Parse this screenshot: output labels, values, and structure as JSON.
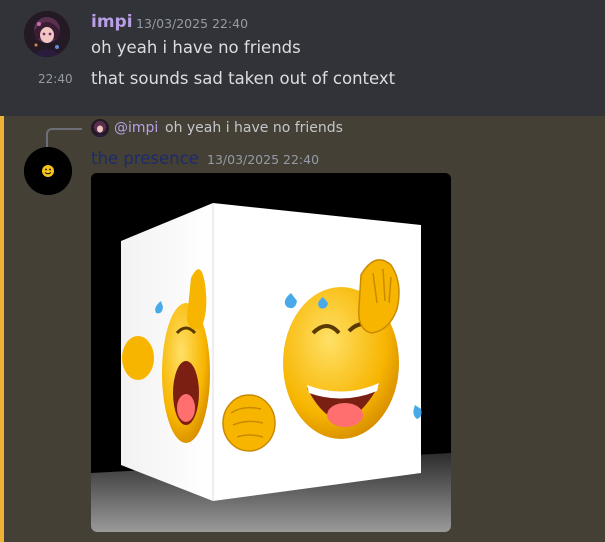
{
  "messages": [
    {
      "author": "impi",
      "timestamp": "13/03/2025 22:40",
      "lines": [
        {
          "text": "oh yeah i have no friends"
        },
        {
          "time": "22:40",
          "text": "that sounds sad taken out of context"
        }
      ],
      "author_color": "#b9a0e6"
    },
    {
      "reply": {
        "author": "@impi",
        "text": "oh yeah i have no friends"
      },
      "author": "the presence",
      "timestamp": "13/03/2025 22:40",
      "author_color": "#1b2b6e",
      "attachment": {
        "icon": "laughing-crying-emoji-cube-gif"
      }
    }
  ],
  "colors": {
    "background": "#313338",
    "mention_highlight": "#444036",
    "mention_bar": "#f0b232",
    "message_text": "#dbdee1",
    "timestamp": "#949ba4"
  }
}
